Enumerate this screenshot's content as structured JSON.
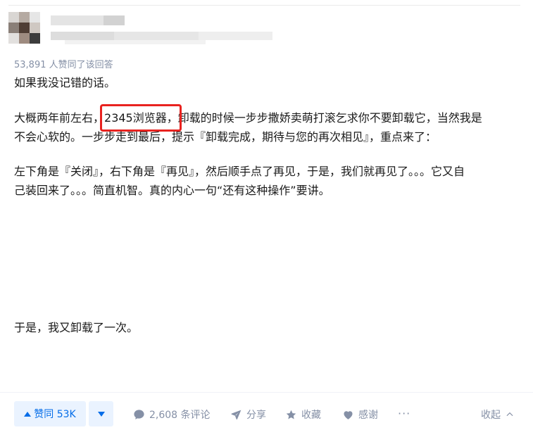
{
  "answer": {
    "voters_text": "53,891 人赞同了该回答",
    "paragraphs": {
      "p1": "如果我没记错的话。",
      "p2_before": "大概两年前左右，",
      "p2_highlight": "2345浏览器，",
      "p2_after": "卸载的时候一步步撒娇卖萌打滚乞求你不要卸载它，当然我是",
      "p3": "不会心软的。一步步走到最后，提示『卸载完成，期待与您的再次相见』，重点来了：",
      "p4": "左下角是『关闭』，右下角是『再见』，然后顺手点了再见，于是，我们就再见了。。。它又自",
      "p5": "己装回来了。。。简直机智。真的内心一句“还有这种操作”要讲。",
      "p6": "于是，我又卸载了一次。"
    },
    "highlight_color": "#e8221f"
  },
  "actions": {
    "upvote_label": "赞同 53K",
    "comments_label": "2,608 条评论",
    "share_label": "分享",
    "favorite_label": "收藏",
    "thanks_label": "感谢",
    "more_label": "···",
    "collapse_label": "收起",
    "accent_color": "#056de8"
  }
}
